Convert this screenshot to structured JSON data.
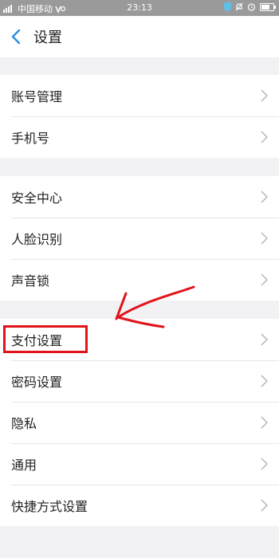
{
  "status_bar": {
    "carrier": "中国移动",
    "time": "23:13"
  },
  "header": {
    "back_icon": "chevron-left-icon",
    "title": "设置"
  },
  "settings": {
    "group1": [
      {
        "label": "账号管理"
      },
      {
        "label": "手机号"
      }
    ],
    "group2": [
      {
        "label": "安全中心"
      },
      {
        "label": "人脸识别"
      },
      {
        "label": "声音锁"
      }
    ],
    "group3": [
      {
        "label": "支付设置"
      },
      {
        "label": "密码设置"
      },
      {
        "label": "隐私"
      },
      {
        "label": "通用"
      },
      {
        "label": "快捷方式设置"
      }
    ]
  },
  "colors": {
    "accent": "#2a8ee6",
    "annotation": "#e0141a",
    "background": "#f2f2f4"
  }
}
